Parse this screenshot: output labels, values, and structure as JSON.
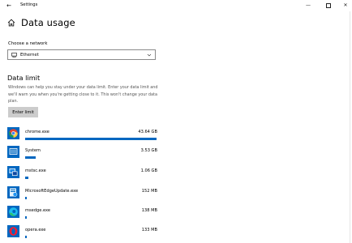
{
  "window": {
    "title": "Settings",
    "back_glyph": "←",
    "minimize_glyph": "—",
    "close_glyph": "✕"
  },
  "header": {
    "title": "Data usage"
  },
  "network": {
    "label": "Choose a network",
    "selected": "Ethernet"
  },
  "data_limit": {
    "title": "Data limit",
    "description": "Windows can help you stay under your data limit. Enter your data limit and we'll warn you when you're getting close to it. This won't change your data plan.",
    "button_label": "Enter limit"
  },
  "apps": [
    {
      "name": "chrome.exe",
      "size": "43.64 GB",
      "usage_fraction": 1.0,
      "icon": "chrome-icon"
    },
    {
      "name": "System",
      "size": "3.53 GB",
      "usage_fraction": 0.081,
      "icon": "system-icon"
    },
    {
      "name": "mstsc.exe",
      "size": "1.06 GB",
      "usage_fraction": 0.024,
      "icon": "remote-desktop-icon"
    },
    {
      "name": "MicrosoftEdgeUpdate.exe",
      "size": "152 MB",
      "usage_fraction": 0.0035,
      "icon": "edge-update-icon"
    },
    {
      "name": "msedge.exe",
      "size": "138 MB",
      "usage_fraction": 0.0032,
      "icon": "edge-icon"
    },
    {
      "name": "opera.exe",
      "size": "133 MB",
      "usage_fraction": 0.003,
      "icon": "opera-icon"
    }
  ],
  "colors": {
    "accent": "#0067c0",
    "button_bg": "#cccccc"
  }
}
